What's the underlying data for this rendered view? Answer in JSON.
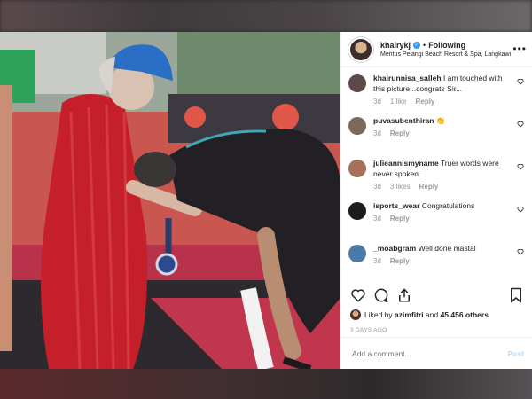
{
  "post": {
    "username": "khairykj",
    "follow_state": "Following",
    "location": "Meritus Pelangi Beach Resort & Spa, Langkawi",
    "header_separator": "•"
  },
  "comments": [
    {
      "user": "khairunnisa_salleh",
      "text": "I am touched with this picture...congrats Sir...",
      "age": "3d",
      "likes": "1 like",
      "reply": "Reply",
      "avatar_color": "#5b4a48"
    },
    {
      "user": "puvasubenthiran",
      "text": "👏",
      "age": "3d",
      "likes": "",
      "reply": "Reply",
      "avatar_color": "#7b6a5c"
    },
    {
      "user": "julieannismyname",
      "text": "Truer words were never spoken.",
      "age": "3d",
      "likes": "3 likes",
      "reply": "Reply",
      "avatar_color": "#a5715a"
    },
    {
      "user": "isports_wear",
      "text": "Congratulations",
      "age": "3d",
      "likes": "",
      "reply": "Reply",
      "avatar_color": "#1c1c1c"
    },
    {
      "user": "_moabgram",
      "text": "Well done mastal",
      "age": "3d",
      "likes": "",
      "reply": "Reply",
      "avatar_color": "#4b7aa8"
    }
  ],
  "likes": {
    "prefix": "Liked by",
    "user": "azimfitri",
    "joiner": "and",
    "count": "45,456 others"
  },
  "timestamp": "3 DAYS AGO",
  "add_comment": {
    "placeholder": "Add a comment...",
    "post_label": "Post"
  },
  "icons": {
    "header_more": "more-options-icon",
    "like": "heart-icon",
    "comment": "comment-icon",
    "share": "share-icon",
    "save": "bookmark-icon"
  },
  "colors": {
    "accent": "#3897f0",
    "muted": "#999999",
    "text": "#262626",
    "post_disabled": "#b3dbff"
  }
}
